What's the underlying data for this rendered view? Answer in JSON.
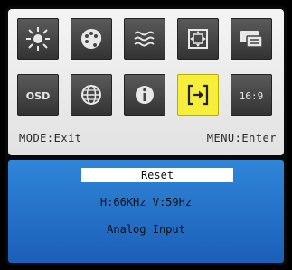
{
  "menu": {
    "items": [
      {
        "icon": "brightness-icon"
      },
      {
        "icon": "color-palette-icon"
      },
      {
        "icon": "wave-icon"
      },
      {
        "icon": "image-position-icon"
      },
      {
        "icon": "input-source-icon"
      },
      {
        "icon": "osd-icon",
        "text": "OSD"
      },
      {
        "icon": "globe-icon"
      },
      {
        "icon": "info-icon"
      },
      {
        "icon": "reset-icon",
        "selected": true
      },
      {
        "icon": "aspect-ratio-icon",
        "text": "16:9"
      }
    ],
    "mode_hint": "MODE:Exit",
    "menu_hint": "MENU:Enter"
  },
  "panel": {
    "reset_label": "Reset",
    "frequency": "H:66KHz V:59Hz",
    "input": "Analog Input"
  },
  "colors": {
    "selected": "#f6ee3a",
    "panel": "#2f86d8"
  }
}
